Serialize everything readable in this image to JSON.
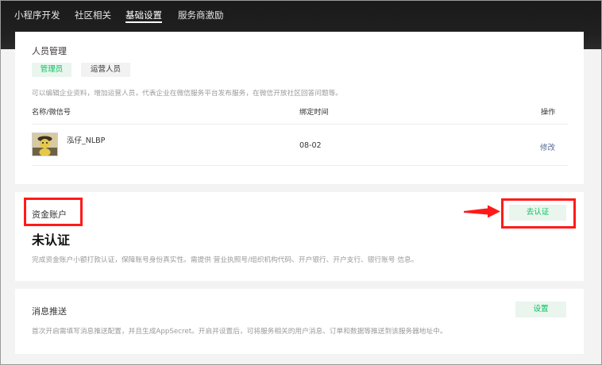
{
  "nav": {
    "items": [
      {
        "label": "小程序开发",
        "active": false
      },
      {
        "label": "社区相关",
        "active": false
      },
      {
        "label": "基础设置",
        "active": true
      },
      {
        "label": "服务商激励",
        "active": false
      }
    ]
  },
  "personnel": {
    "title": "人员管理",
    "tabs": [
      {
        "label": "管理员",
        "selected": true
      },
      {
        "label": "运营人员",
        "selected": false
      }
    ],
    "description": "可以编辑企业资料，增加运营人员，代表企业在微信服务平台发布服务，在微信开放社区回答问题等。",
    "table": {
      "headers": [
        "名称/微信号",
        "绑定时间",
        "操作"
      ],
      "rows": [
        {
          "name": "泓仔_NLBP",
          "bind_time": "08-02",
          "action": "修改"
        }
      ]
    }
  },
  "fund_account": {
    "title": "资金账户",
    "status": "未认证",
    "action_label": "去认证",
    "description": "完成资金账户小额打款认证，保障账号身份真实性。需提供 营业执照号/组织机构代码、开户银行、开户支行、银行账号 信息。"
  },
  "message_push": {
    "title": "消息推送",
    "action_label": "设置",
    "description": "首次开启需填写消息推送配置，并且生成AppSecret。开启并设置后，可将服务相关的用户消息、订单和数据等推送到该服务器地址中。"
  },
  "colors": {
    "nav_bg": "#1e1e1e",
    "accent_green": "#07c160",
    "link_blue": "#576b95",
    "annotation_red": "#ff1a1a"
  }
}
